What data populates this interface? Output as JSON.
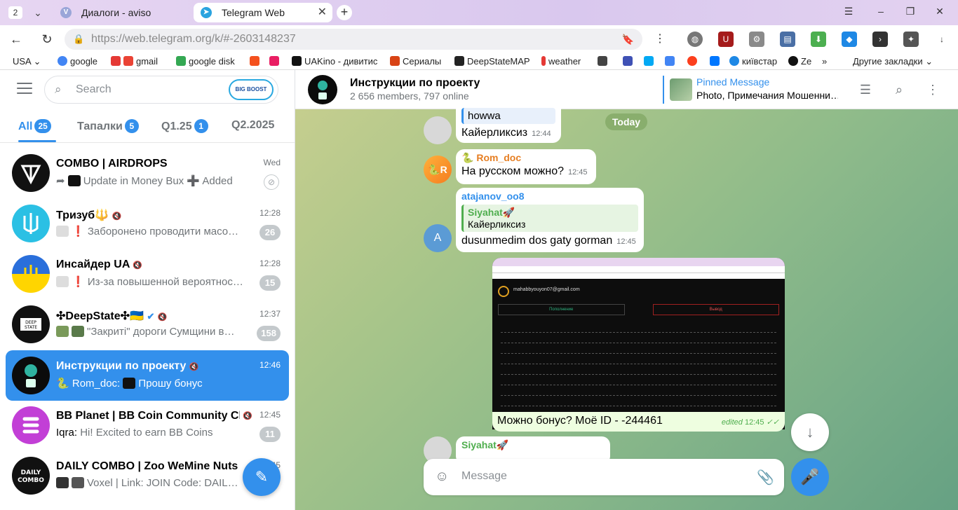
{
  "browser": {
    "tab_count": "2",
    "tabs": [
      {
        "title": "Диалоги - aviso",
        "favicon": "V"
      },
      {
        "title": "Telegram Web",
        "favicon": "telegram-icon"
      }
    ],
    "url": "https://web.telegram.org/k/#-2603148237",
    "url_domain": "https://web.telegram.org",
    "url_path": "/k/#-2603148237",
    "bookmarks": [
      "USA",
      "google",
      "gmail",
      "google disk",
      "UAKino - дивитис",
      "Сериалы",
      "DeepStateMAP",
      "weather",
      "київстар",
      "Ze",
      "Другие закладки"
    ]
  },
  "sidebar": {
    "search_placeholder": "Search",
    "promo_badge": "BIG BOOST",
    "folders": [
      {
        "label": "All",
        "count": "25"
      },
      {
        "label": "Тапалки",
        "count": "5"
      },
      {
        "label": "Q1.25",
        "count": "1"
      },
      {
        "label": "Q2.2025",
        "count": ""
      }
    ],
    "chats": [
      {
        "name": "COMBO | AIRDROPS",
        "time": "Wed",
        "preview": "Update in Money Bux ➕ Added",
        "badge": ""
      },
      {
        "name": "Тризуб🔱",
        "time": "12:28",
        "preview": "❗ Заборонено проводити масо…",
        "badge": "26"
      },
      {
        "name": "Инсайдер UA",
        "time": "12:28",
        "preview": "❗ Из-за повышенной вероятнос…",
        "badge": "15"
      },
      {
        "name": "✣DeepState✣🇺🇦",
        "time": "12:37",
        "preview": "\"Закриті\" дороги Сумщини в…",
        "badge": "158"
      },
      {
        "name": "Инструкции по проекту",
        "time": "12:46",
        "preview_sender": "Rom_doc:",
        "preview": "Прошу бонус",
        "badge": ""
      },
      {
        "name": "BB Planet | BB Coin Community Ch…",
        "time": "12:45",
        "preview_sender": "Iqra:",
        "preview": "Hi! Excited to earn BB Coins",
        "badge": "11"
      },
      {
        "name": "DAILY COMBO | Zoo WeMine Nuts …",
        "time": "12:45",
        "preview": "Voxel | Link: JOIN Code: DAIL…",
        "badge": ""
      }
    ]
  },
  "chat": {
    "title": "Инструкции по проекту",
    "subtitle": "2 656 members, 797 online",
    "pinned_title": "Pinned Message",
    "pinned_text": "Photo, Примечания Мошенни…",
    "date_label": "Today",
    "messages": [
      {
        "reply_text": "howwa",
        "text": "Кайерликсиз",
        "time": "12:44"
      },
      {
        "sender": "Rom_doc",
        "avatar": "R",
        "text": "На русском можно?",
        "time": "12:45"
      },
      {
        "sender": "atajanov_oo8",
        "avatar": "A",
        "reply_name": "Siyahat🚀",
        "reply_text": "Кайерликсиз",
        "text": "dusunmedim dos gaty gorman",
        "time": "12:45"
      },
      {
        "caption": "Можно бонус? Моё ID - -244461",
        "edited": "edited",
        "time": "12:45"
      },
      {
        "sender": "Siyahat🚀"
      }
    ],
    "screenshot_texts": {
      "email": "mahabbyouyon07@gmail.com",
      "btn1": "Пополнение",
      "btn2": "Вывод"
    },
    "composer_placeholder": "Message"
  },
  "colors": {
    "accent": "#3390ec",
    "green": "#4fae4e",
    "bg_chat": "#9fbf88"
  }
}
